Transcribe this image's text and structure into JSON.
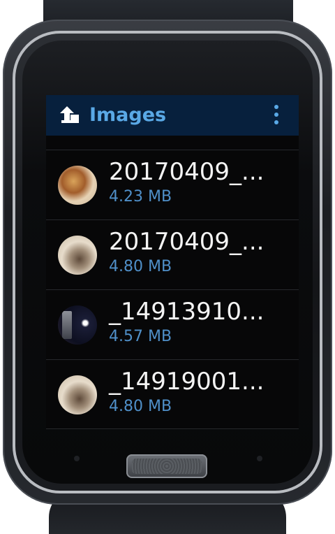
{
  "app_bar": {
    "title": "Images",
    "up_icon": "up-arrow-folder-icon",
    "menu_icon": "overflow-menu-icon",
    "accent_color": "#5aa9e6",
    "background_color": "#07203d"
  },
  "files": [
    {
      "name": "20170409_...",
      "size": "4.23 MB",
      "thumbnail": "food-photo"
    },
    {
      "name": "20170409_...",
      "size": "4.80 MB",
      "thumbnail": "cat-photo"
    },
    {
      "name": "_14913910...",
      "size": "4.57 MB",
      "thumbnail": "phone-screenshot"
    },
    {
      "name": "_14919001...",
      "size": "4.80 MB",
      "thumbnail": "cat-photo"
    }
  ]
}
